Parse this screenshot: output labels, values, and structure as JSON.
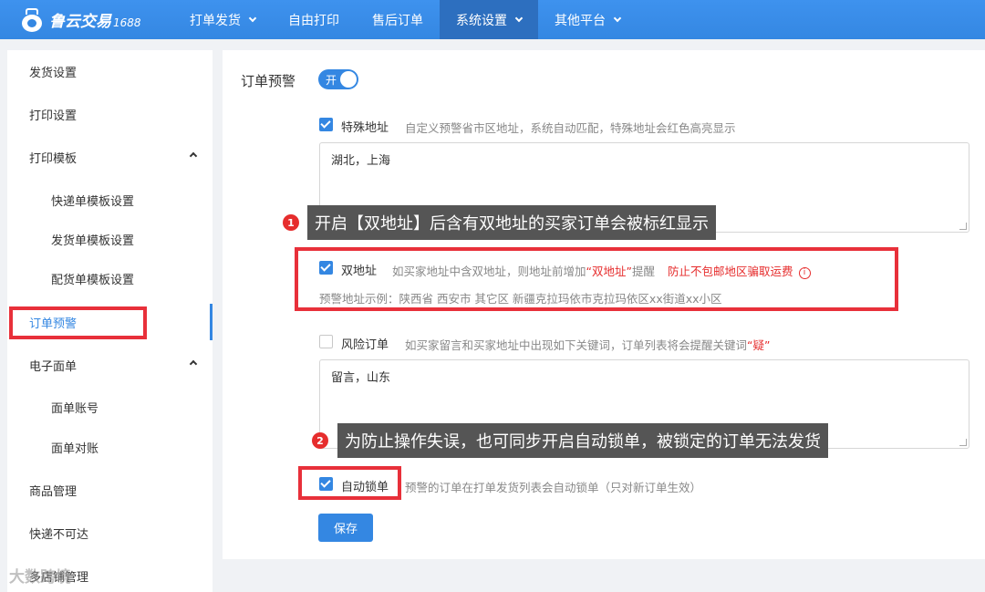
{
  "brand": {
    "name": "鲁云交易",
    "suffix": "1688"
  },
  "topnav": [
    {
      "label": "打单发货",
      "dropdown": true,
      "active": false
    },
    {
      "label": "自由打印",
      "dropdown": false,
      "active": false
    },
    {
      "label": "售后订单",
      "dropdown": false,
      "active": false
    },
    {
      "label": "系统设置",
      "dropdown": true,
      "active": true
    },
    {
      "label": "其他平台",
      "dropdown": true,
      "active": false
    }
  ],
  "sidebar": {
    "items": [
      {
        "label": "发货设置"
      },
      {
        "label": "打印设置"
      },
      {
        "label": "打印模板"
      },
      {
        "label": "快递单模板设置"
      },
      {
        "label": "发货单模板设置"
      },
      {
        "label": "配货单模板设置"
      },
      {
        "label": "订单预警"
      },
      {
        "label": "电子面单"
      },
      {
        "label": "面单账号"
      },
      {
        "label": "面单对账"
      },
      {
        "label": "商品管理"
      },
      {
        "label": "快递不可达"
      },
      {
        "label": "多店铺管理"
      }
    ]
  },
  "main": {
    "title": "订单预警",
    "toggle_label": "开",
    "special_address": {
      "label": "特殊地址",
      "desc": "自定义预警省市区地址，系统自动匹配，特殊地址会红色高亮显示",
      "value": "湖北，上海"
    },
    "double_address": {
      "label": "双地址",
      "desc_prefix": "如买家地址中含双地址，则地址前增加",
      "desc_quote": "“双地址”",
      "desc_suffix": "提醒",
      "warn": "防止不包邮地区骗取运费",
      "example": "预警地址示例：陕西省 西安市 其它区 新疆克拉玛依市克拉玛依区xx街道xx小区"
    },
    "risk_order": {
      "label": "风险订单",
      "desc_prefix": "如买家留言和买家地址中出现如下关键词，订单列表将会提醒关键词",
      "desc_quote": "“疑”",
      "value": "留言，山东"
    },
    "auto_lock": {
      "label": "自动锁单",
      "desc": "预警的订单在打单发货列表会自动锁单（只对新订单生效）"
    },
    "save_label": "保存"
  },
  "annotations": {
    "callout1": {
      "num": "1",
      "text": "开启【双地址】后含有双地址的买家订单会被标红显示"
    },
    "callout2": {
      "num": "2",
      "text": "为防止操作失误，也可同步开启自动锁单，被锁定的订单无法发货"
    }
  },
  "watermark": "大数跨境",
  "colors": {
    "primary": "#3487e2",
    "annotation_red": "#e8303a"
  }
}
